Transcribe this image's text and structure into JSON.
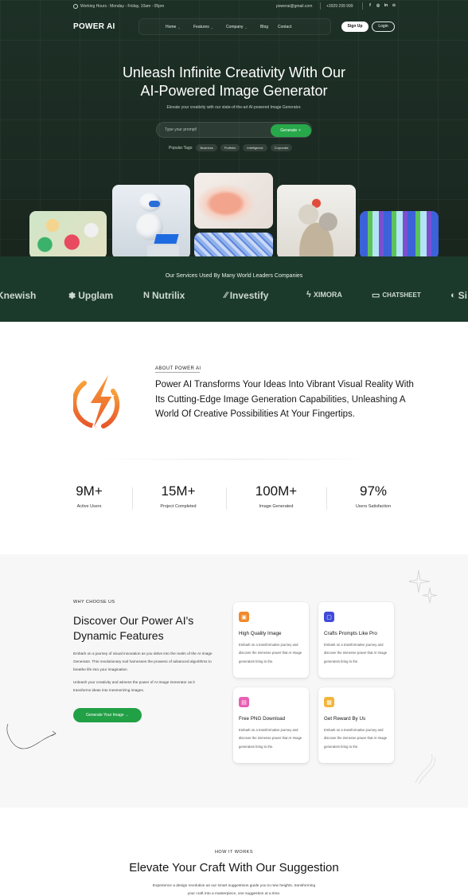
{
  "topbar": {
    "hours": "Working Hours : Monday - Friday, 10am - 05pm",
    "email": "powerai@gmail.com",
    "phone": "+3929 299 999",
    "socials": [
      "f",
      "◎",
      "in",
      "⊙"
    ]
  },
  "header": {
    "logo": "POWER AI",
    "nav": [
      "Home",
      "Features",
      "Company",
      "Blog",
      "Contact"
    ],
    "signup": "Sign Up",
    "login": "Login"
  },
  "hero": {
    "title_line1": "Unleash Infinite Creativity With Our",
    "title_line2": "AI-Powered Image Generator",
    "subtitle": "Elevate your creativity with our state-of-the-art AI-powered Image Generator.",
    "prompt_placeholder": "Type your prompt!",
    "generate": "Generate ✧",
    "popular_label": "Popular Tags:",
    "tags": [
      "Business",
      "Portfolio",
      "Intelligence",
      "Corporate"
    ]
  },
  "services": {
    "title": "Our Services Used By Many World Leaders Companies",
    "brands": [
      "Knewish",
      "Upglam",
      "Nutrilix",
      "Investify",
      "XIMORA",
      "CHATSHEET",
      "Si"
    ]
  },
  "about": {
    "eyebrow": "ABOUT POWER AI",
    "text": "Power AI Transforms Your Ideas Into Vibrant Visual Reality With Its Cutting-Edge Image Generation Capabilities, Unleashing A World Of Creative Possibilities At Your Fingertips."
  },
  "stats": [
    {
      "value": "9M+",
      "label": "Active Users"
    },
    {
      "value": "15M+",
      "label": "Project Completed"
    },
    {
      "value": "100M+",
      "label": "Image Generated"
    },
    {
      "value": "97%",
      "label": "Users Satisfaction"
    }
  ],
  "why": {
    "eyebrow": "WHY CHOOSE US",
    "title": "Discover Our Power AI's Dynamic Features",
    "p1": "Embark on a journey of visual innovation as you delve into the realm of the AI Image Generator. This revolutionary tool harnesses the prowess of advanced algorithms to breathe life into your imagination",
    "p2": "Unleash your creativity and witness the power of AI Image Generator as it transforms ideas into mesmerizing images.",
    "button": "Generate Your Image →",
    "cards": [
      {
        "title": "High Quality Image",
        "desc": "Embark on a transformative journey and discover the immense power that AI Image generators bring to the.",
        "icon": "image-icon",
        "color": "#f2892b"
      },
      {
        "title": "Crafts Prompts Like Pro",
        "desc": "Embark on a transformative journey and discover the immense power that AI Image generators bring to the.",
        "icon": "chat-icon",
        "color": "#3f4bd8"
      },
      {
        "title": "Free PNG Download",
        "desc": "Embark on a transformative journey and discover the immense power that AI Image generators bring to the.",
        "icon": "file-icon",
        "color": "#e95fb3"
      },
      {
        "title": "Get Reward By Us",
        "desc": "Embark on a transformative journey and discover the immense power that AI Image generators bring to the.",
        "icon": "gift-icon",
        "color": "#f2b53b"
      }
    ]
  },
  "how": {
    "eyebrow": "HOW IT WORKS",
    "title": "Elevate Your Craft With Our Suggestion",
    "subtitle": "Experience a design revolution as our smart suggestions guide you to new heights, transforming your craft into a masterpiece, one suggestion at a time."
  },
  "colors": {
    "hero_bg": "#1b2a22",
    "accent_green": "#27a84a",
    "brand_orange": "#f2892b"
  }
}
